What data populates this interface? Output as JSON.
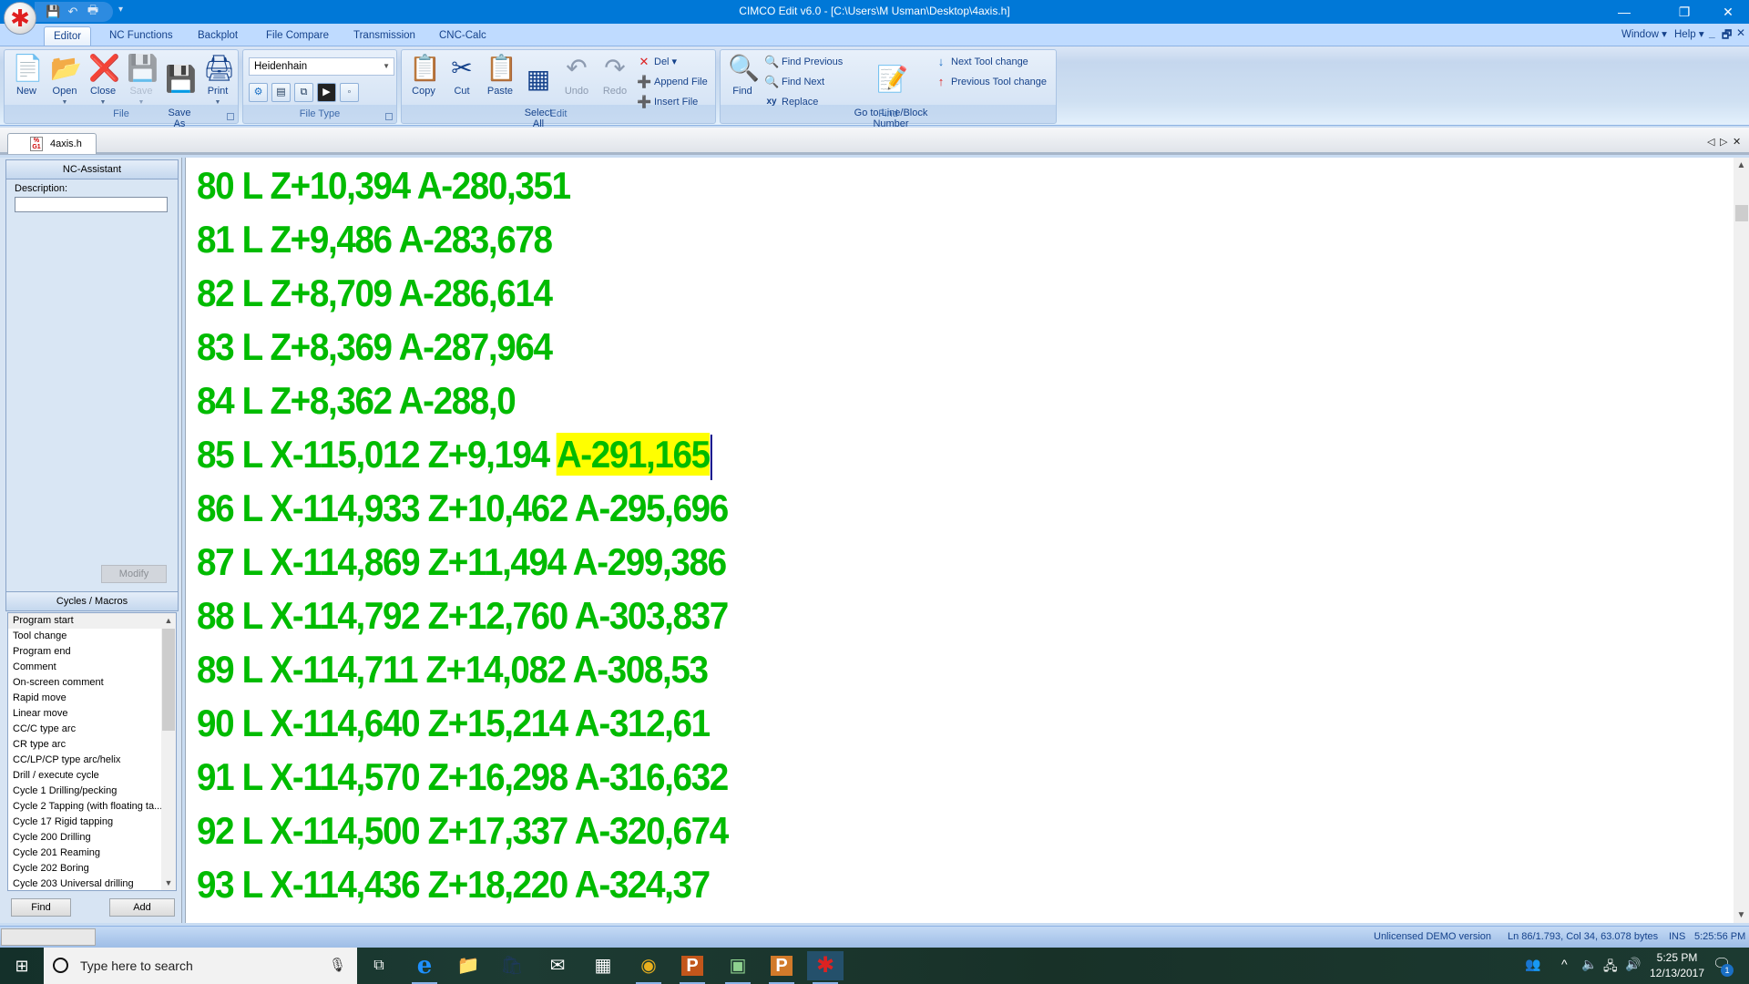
{
  "window": {
    "title": "CIMCO Edit v6.0 - [C:\\Users\\M Usman\\Desktop\\4axis.h]",
    "controls": {
      "minimize": "—",
      "restore": "❐",
      "close": "✕"
    }
  },
  "quick_access": {
    "save": "💾",
    "undo": "↶",
    "print": "🖶",
    "more": "▾"
  },
  "ribbon_tabs": [
    {
      "label": "Editor",
      "active": true
    },
    {
      "label": "NC Functions"
    },
    {
      "label": "Backplot"
    },
    {
      "label": "File Compare"
    },
    {
      "label": "Transmission"
    },
    {
      "label": "CNC-Calc"
    }
  ],
  "right_menus": {
    "window": "Window ▾",
    "help": "Help ▾"
  },
  "mdi_controls": {
    "minimize": "_",
    "restore": "🗗",
    "close": "✕"
  },
  "ribbon": {
    "file_group": {
      "label": "File",
      "buttons": [
        {
          "label": "New",
          "icon": "📄"
        },
        {
          "label": "Open",
          "icon": "📂",
          "dropdown": true
        },
        {
          "label": "Close",
          "icon": "❌",
          "dropdown": true
        },
        {
          "label": "Save",
          "icon": "💾",
          "dropdown": true,
          "disabled": true
        },
        {
          "label": "Save\nAs",
          "icon": "💾"
        },
        {
          "label": "Print",
          "icon": "🖨",
          "dropdown": true
        }
      ]
    },
    "filetype_group": {
      "label": "File Type",
      "selected": "Heidenhain",
      "tool_buttons": [
        "⚙",
        "▤",
        "⧉",
        "▶",
        "◦"
      ]
    },
    "edit_group": {
      "label": "Edit",
      "big_buttons": [
        {
          "label": "Copy",
          "icon": "📋"
        },
        {
          "label": "Cut",
          "icon": "✂"
        },
        {
          "label": "Paste",
          "icon": "📋"
        },
        {
          "label": "Select\nAll",
          "icon": "▦"
        },
        {
          "label": "Undo",
          "icon": "↶",
          "disabled": true
        },
        {
          "label": "Redo",
          "icon": "↷",
          "disabled": true
        }
      ],
      "small_buttons": [
        {
          "label": "Del ▾",
          "icon": "✕"
        },
        {
          "label": "Append File",
          "icon": "➕"
        },
        {
          "label": "Insert File",
          "icon": "➕"
        }
      ]
    },
    "find_group": {
      "label": "Find",
      "find_button": {
        "label": "Find",
        "icon": "🔍"
      },
      "small_buttons": [
        {
          "label": "Find Previous",
          "icon": "🔍"
        },
        {
          "label": "Find Next",
          "icon": "🔍"
        },
        {
          "label": "Replace",
          "icon": "xy"
        }
      ],
      "goto_button": {
        "label": "Go to Line/Block\nNumber",
        "icon": "📝"
      },
      "tool_change": [
        {
          "label": "Next Tool change",
          "icon": "↓"
        },
        {
          "label": "Previous Tool change",
          "icon": "↑"
        }
      ]
    }
  },
  "document_tab": {
    "label": "4axis.h",
    "icon_text": "%\nG1"
  },
  "tab_nav": {
    "prev": "◁",
    "next": "▷",
    "close": "✕"
  },
  "nc_assistant": {
    "title": "NC-Assistant",
    "description_label": "Description:",
    "description_value": "",
    "modify_label": "Modify"
  },
  "cycles_macros": {
    "title": "Cycles / Macros",
    "items": [
      "Program start",
      "Tool change",
      "Program end",
      "Comment",
      "On-screen comment",
      "Rapid move",
      "Linear move",
      "CC/C type arc",
      "CR type arc",
      "CC/LP/CP type arc/helix",
      "Drill / execute cycle",
      "Cycle 1 Drilling/pecking",
      "Cycle 2 Tapping (with floating ta...",
      "Cycle 17 Rigid tapping",
      "Cycle 200 Drilling",
      "Cycle 201 Reaming",
      "Cycle 202 Boring",
      "Cycle 203 Universal drilling"
    ],
    "selected_index": 0,
    "find_label": "Find",
    "add_label": "Add"
  },
  "editor": {
    "lines": [
      {
        "text": "80 L Z+10,394 A-280,351"
      },
      {
        "text": "81 L Z+9,486 A-283,678"
      },
      {
        "text": "82 L Z+8,709 A-286,614"
      },
      {
        "text": "83 L Z+8,369 A-287,964"
      },
      {
        "text": "84 L Z+8,362 A-288,0"
      },
      {
        "text": "85 L X-115,012 Z+9,194 ",
        "highlight": "A-291,165",
        "caret": true
      },
      {
        "text": "86 L X-114,933 Z+10,462 A-295,696"
      },
      {
        "text": "87 L X-114,869 Z+11,494 A-299,386"
      },
      {
        "text": "88 L X-114,792 Z+12,760 A-303,837"
      },
      {
        "text": "89 L X-114,711 Z+14,082 A-308,53"
      },
      {
        "text": "90 L X-114,640 Z+15,214 A-312,61"
      },
      {
        "text": "91 L X-114,570 Z+16,298 A-316,632"
      },
      {
        "text": "92 L X-114,500 Z+17,337 A-320,674"
      },
      {
        "text": "93 L X-114,436 Z+18,220 A-324,37"
      }
    ],
    "text_color": "#00bb00",
    "highlight_color": "#ffff00"
  },
  "statusbar": {
    "license": "Unlicensed DEMO version",
    "position": "Ln 86/1.793, Col 34, 63.078 bytes",
    "mode": "INS",
    "time": "5:25:56 PM"
  },
  "taskbar": {
    "search_placeholder": "Type here to search",
    "apps": [
      {
        "name": "task-view",
        "icon": "⧉"
      },
      {
        "name": "edge",
        "icon": "e"
      },
      {
        "name": "file-explorer",
        "icon": "📁"
      },
      {
        "name": "store",
        "icon": "🛍"
      },
      {
        "name": "mail",
        "icon": "✉"
      },
      {
        "name": "calculator",
        "icon": "▦"
      },
      {
        "name": "chrome",
        "icon": "◉"
      },
      {
        "name": "powerpoint-1",
        "icon": "P"
      },
      {
        "name": "app-green",
        "icon": "▣"
      },
      {
        "name": "powerpoint-2",
        "icon": "P"
      },
      {
        "name": "cimco",
        "icon": "✱"
      }
    ],
    "tray": {
      "people": "👥",
      "chevron": "^",
      "volume_warn": "🔈",
      "network": "🖧",
      "speaker": "🔊"
    },
    "clock_time": "5:25 PM",
    "clock_date": "12/13/2017",
    "notification_count": "1"
  }
}
